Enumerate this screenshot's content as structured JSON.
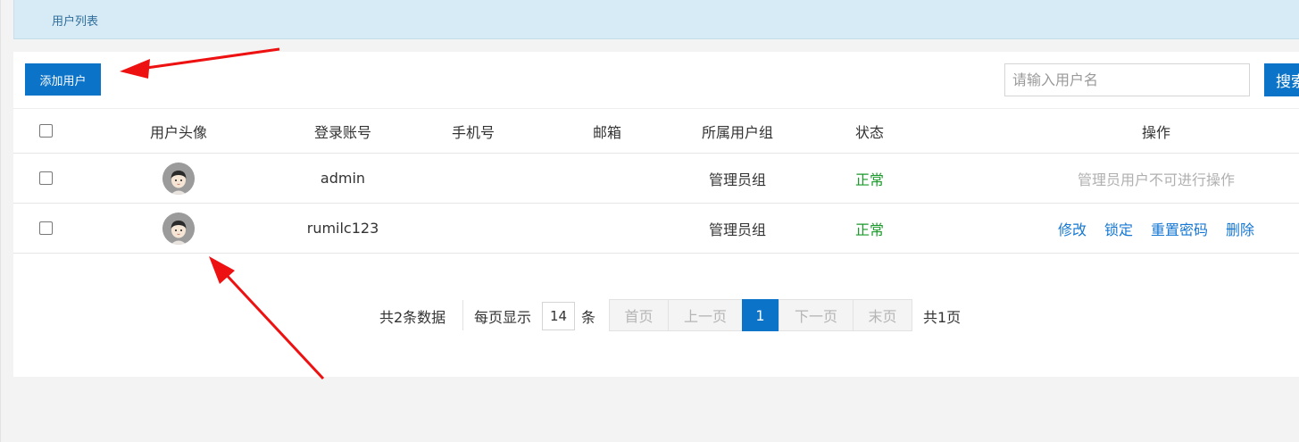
{
  "breadcrumb": {
    "title": "用户列表"
  },
  "toolbar": {
    "add_label": "添加用户",
    "search_placeholder": "请输入用户名",
    "search_label": "搜索"
  },
  "table": {
    "headers": [
      "用户头像",
      "登录账号",
      "手机号",
      "邮箱",
      "所属用户组",
      "状态",
      "操作"
    ],
    "rows": [
      {
        "login": "admin",
        "phone": "",
        "email": "",
        "group": "管理员组",
        "status": "正常",
        "op_note": "管理员用户不可进行操作"
      },
      {
        "login": "rumilc123",
        "phone": "",
        "email": "",
        "group": "管理员组",
        "status": "正常",
        "actions": [
          "修改",
          "锁定",
          "重置密码",
          "删除"
        ]
      }
    ],
    "status_color": "#1a9a2a",
    "avatar_icon": "user-avatar-icon"
  },
  "pagination": {
    "total_text": "共2条数据",
    "per_page_label": "每页显示",
    "per_page_value": "14",
    "per_page_unit": "条",
    "first": "首页",
    "prev": "上一页",
    "current": "1",
    "next": "下一页",
    "last": "末页",
    "pages_text": "共1页"
  },
  "colors": {
    "accent": "#0b73c8",
    "arrow": "#ee1111"
  }
}
